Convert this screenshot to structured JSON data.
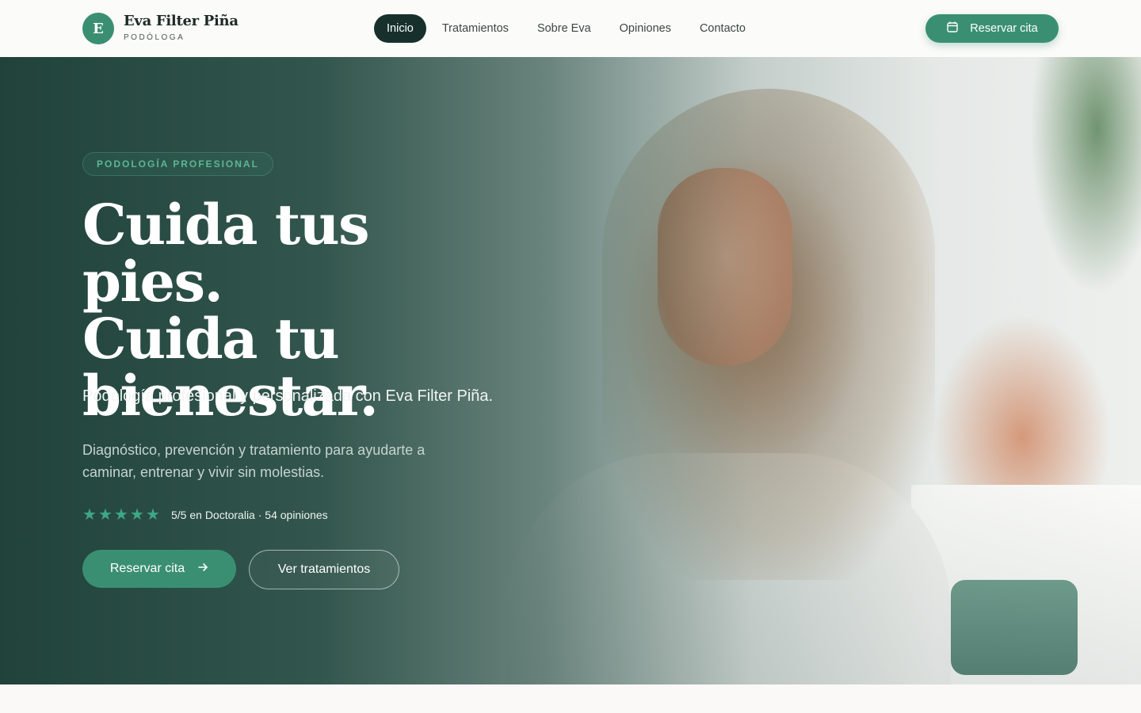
{
  "header": {
    "logo_letter": "E",
    "brand_name": "Eva Filter Piña",
    "brand_role": "PODÓLOGA",
    "nav": [
      {
        "label": "Inicio",
        "active": true
      },
      {
        "label": "Tratamientos",
        "active": false
      },
      {
        "label": "Sobre Eva",
        "active": false
      },
      {
        "label": "Opiniones",
        "active": false
      },
      {
        "label": "Contacto",
        "active": false
      }
    ],
    "cta_label": "Reservar cita",
    "cta_icon": "calendar-icon"
  },
  "hero": {
    "tag": "PODOLOGÍA PROFESIONAL",
    "headline": [
      "Cuida tus pies.",
      "Cuida tu",
      "bienestar."
    ],
    "subtitle": "Podología profesional y personalizada con Eva Filter Piña.",
    "description": "Diagnóstico, prevención y tratamiento para ayudarte a caminar, entrenar y vivir sin molestias.",
    "rating": {
      "stars": 5,
      "text": "5/5 en Doctoralia · 54 opiniones"
    },
    "primary_button": "Reservar cita",
    "primary_button_icon": "arrow-right-icon",
    "secondary_button": "Ver tratamientos"
  },
  "colors": {
    "accent": "#3a8f73",
    "dark": "#17302b",
    "overlay": "#163a32"
  }
}
